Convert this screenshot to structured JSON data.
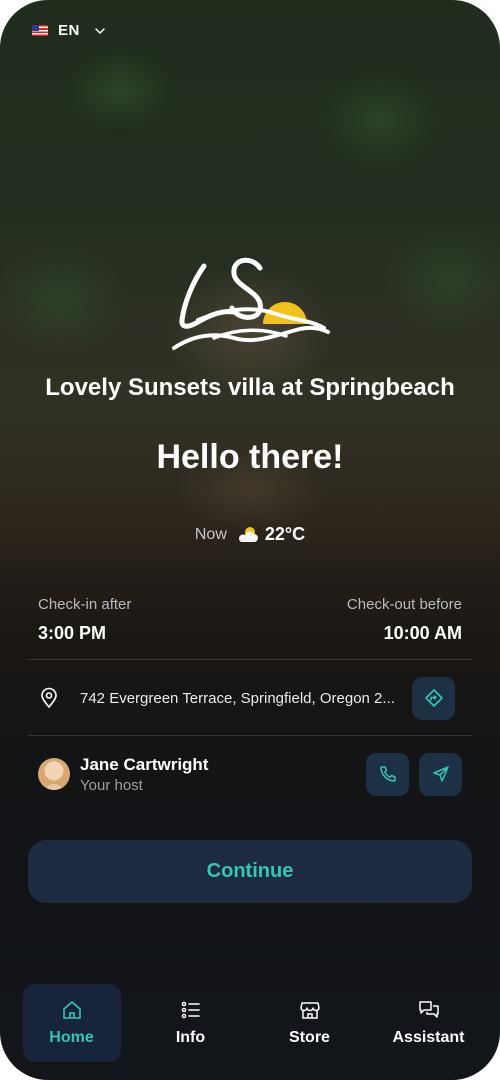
{
  "language": {
    "flag": "us-flag-icon",
    "code": "EN"
  },
  "property": {
    "name": "Lovely Sunsets villa at Springbeach"
  },
  "greeting": "Hello there!",
  "weather": {
    "label": "Now",
    "icon": "partly-cloudy-icon",
    "temperature": "22°C"
  },
  "checkin": {
    "label": "Check-in after",
    "time": "3:00 PM"
  },
  "checkout": {
    "label": "Check-out before",
    "time": "10:00 AM"
  },
  "address": {
    "text": "742 Evergreen Terrace, Springfield, Oregon 2..."
  },
  "host": {
    "name": "Jane Cartwright",
    "role": "Your host"
  },
  "continue_label": "Continue",
  "nav": {
    "items": [
      {
        "label": "Home",
        "icon": "home-icon",
        "active": true
      },
      {
        "label": "Info",
        "icon": "list-icon",
        "active": false
      },
      {
        "label": "Store",
        "icon": "store-icon",
        "active": false
      },
      {
        "label": "Assistant",
        "icon": "chat-icon",
        "active": false
      }
    ]
  },
  "colors": {
    "accent": "#35c6b3",
    "button_bg": "#1c2b3f",
    "icon_button_bg": "#1d3044",
    "sun": "#f2c21b"
  }
}
